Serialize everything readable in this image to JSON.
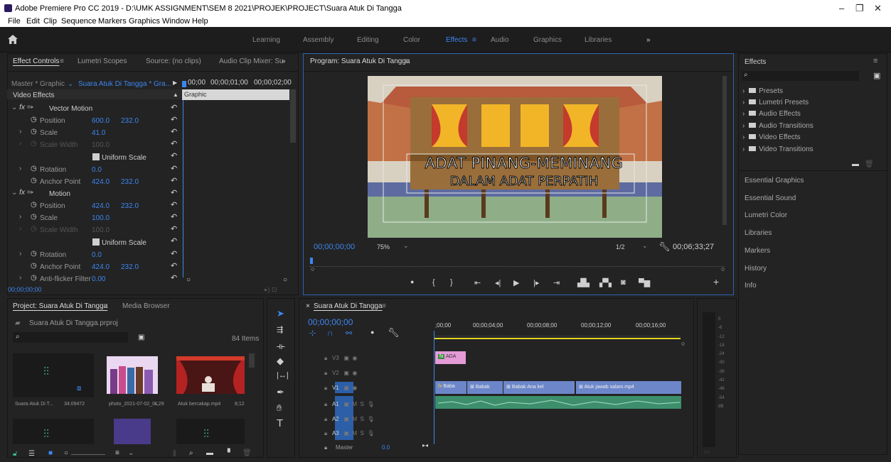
{
  "window": {
    "title": "Adobe Premiere Pro CC 2019 - D:\\UMK ASSIGNMENT\\SEM 8 2021\\PROJEK\\PROJECT\\Suara Atuk Di Tangga",
    "minimize": "–",
    "restore": "❐",
    "close": "✕"
  },
  "menu": [
    "File",
    "Edit",
    "Clip",
    "Sequence",
    "Markers",
    "Graphics",
    "Window",
    "Help"
  ],
  "workspaces": [
    "Learning",
    "Assembly",
    "Editing",
    "Color",
    "Effects",
    "Audio",
    "Graphics",
    "Libraries",
    "»"
  ],
  "effect_controls": {
    "tabs": [
      "Effect Controls",
      "Lumetri Scopes",
      "Source: (no clips)",
      "Audio Clip Mixer: Su",
      "»"
    ],
    "master": "Master * Graphic",
    "sequence": "Suara Atuk Di Tangga * Gra...",
    "ruler": [
      "00;00",
      "00;00;01;00",
      "00;00;02;00"
    ],
    "section": "Video Effects",
    "graphic_clip": "Graphic",
    "vector_motion": "Vector Motion",
    "motion": "Motion",
    "props": {
      "position": "Position",
      "scale": "Scale",
      "scale_width": "Scale Width",
      "uniform_scale": "Uniform Scale",
      "rotation": "Rotation",
      "anchor": "Anchor Point",
      "anti_flicker": "Anti-flicker Filter"
    },
    "values": {
      "vm_pos_x": "600.0",
      "vm_pos_y": "232.0",
      "vm_scale": "41.0",
      "vm_scale_width": "100.0",
      "vm_rot": "0.0",
      "vm_anchor_x": "424.0",
      "vm_anchor_y": "232.0",
      "m_pos_x": "424.0",
      "m_pos_y": "232.0",
      "m_scale": "100.0",
      "m_scale_width": "100.0",
      "m_rot": "0.0",
      "m_anchor_x": "424.0",
      "m_anchor_y": "232.0",
      "m_anti_flicker": "0.00"
    },
    "timecode": "00;00;00;00"
  },
  "program": {
    "title": "Program: Suara Atuk Di Tangga",
    "title_line1": "ADAT PINANG-MEMINANG",
    "title_line2": "DALAM ADAT PERPATIH",
    "timecode": "00;00;00;00",
    "zoom": "75%",
    "resolution": "1/2",
    "duration": "00;06;33;27"
  },
  "project": {
    "tabs": [
      "Project: Suara Atuk Di Tangga",
      "Media Browser"
    ],
    "file": "Suara Atuk Di Tangga.prproj",
    "items_count": "84 Items",
    "items": [
      {
        "name": "Suara Atuk Di T...",
        "dur": "34:09472"
      },
      {
        "name": "photo_2021-07-02_0...",
        "dur": "4;29"
      },
      {
        "name": "Atuk bercakap.mp4",
        "dur": "8;12"
      }
    ]
  },
  "timeline": {
    "title": "Suara Atuk Di Tangga",
    "timecode": "00;00;00;00",
    "ruler": [
      ";00;00",
      "00;00;04;00",
      "00;00;08;00",
      "00;00;12;00",
      "00;00;16;00"
    ],
    "tracks": [
      "V3",
      "V2",
      "V1",
      "A1",
      "A2",
      "A3"
    ],
    "master": "Master",
    "master_val": "0.0",
    "clips": {
      "v3": "ADA",
      "v1a": "Baba",
      "v1b": "Babak",
      "v1c": "Babak Ana kel",
      "v1d": "Atuk jawab salam.mp4"
    },
    "meter_labels": [
      "0",
      "-6",
      "-12",
      "-18",
      "-24",
      "-30",
      "-36",
      "-42",
      "-48",
      "-54",
      "dB"
    ]
  },
  "effects_panel": {
    "title": "Effects",
    "items": [
      "Presets",
      "Lumetri Presets",
      "Audio Effects",
      "Audio Transitions",
      "Video Effects",
      "Video Transitions"
    ],
    "sections": [
      "Essential Graphics",
      "Essential Sound",
      "Lumetri Color",
      "Libraries",
      "Markers",
      "History",
      "Info"
    ]
  },
  "colors": {
    "accent": "#3d86f1",
    "clip_purple": "#e49bd7",
    "clip_blue": "#6c86c9",
    "audio_green": "#3d8f6c"
  }
}
